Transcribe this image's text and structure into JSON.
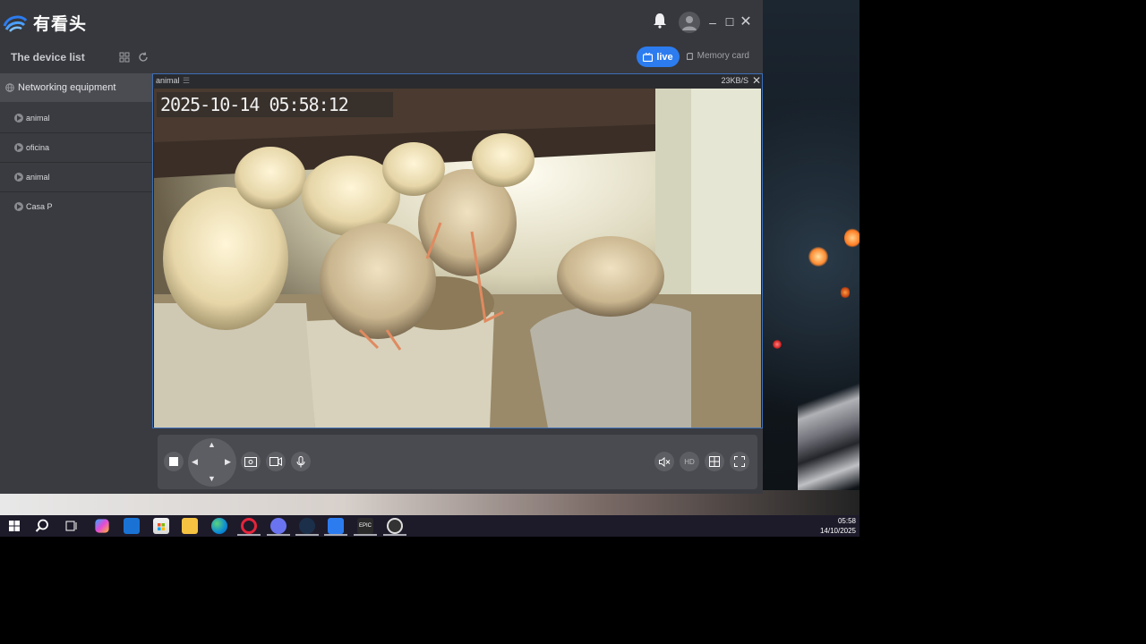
{
  "app": {
    "brand": "有看头",
    "device_list_title": "The device list",
    "live_label": "live",
    "memory_tab_label": "Memory card"
  },
  "sidebar": {
    "group_label": "Networking equipment",
    "items": [
      {
        "label": "animal"
      },
      {
        "label": "oficina"
      },
      {
        "label": "animal"
      },
      {
        "label": "Casa P"
      }
    ]
  },
  "video": {
    "camera_name": "animal",
    "bitrate": "23KB/S",
    "timestamp": "2025-10-14  05:58:12"
  },
  "controls": {
    "hd_label": "HD"
  },
  "taskbar": {
    "time": "05:58",
    "date": "14/10/2025",
    "icons": [
      "windows-start",
      "search",
      "task-view",
      "copilot",
      "outlook",
      "store",
      "file-explorer",
      "edge",
      "opera",
      "discord",
      "steam",
      "app-camera",
      "epic-games",
      "app-red"
    ]
  },
  "colors": {
    "accent": "#2c7cf0",
    "app_bg": "#3a3b40",
    "video_border": "#3d6fb8"
  }
}
